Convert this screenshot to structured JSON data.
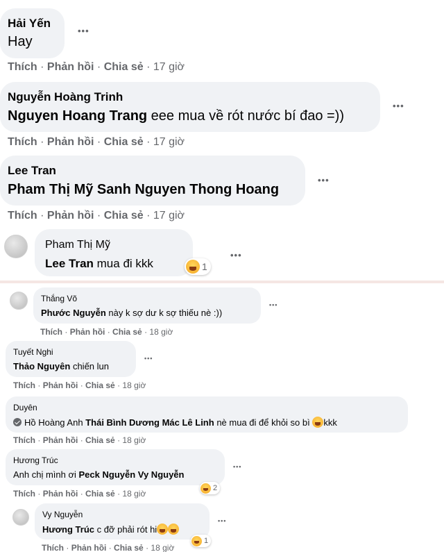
{
  "top_section": {
    "comments": [
      {
        "author": "Hải Yến",
        "text": "Hay",
        "actions": {
          "like": "Thích",
          "reply": "Phản hồi",
          "share": "Chia sẻ",
          "time": "17 giờ"
        }
      },
      {
        "author": "Nguyễn Hoàng Trinh",
        "tag": "Nguyen Hoang Trang",
        "text": " eee mua về rót nước bí đao =))",
        "actions": {
          "like": "Thích",
          "reply": "Phản hồi",
          "share": "Chia sẻ",
          "time": "17 giờ"
        }
      },
      {
        "author": "Lee Tran",
        "tag": "Pham Thị Mỹ Sanh Nguyen Thong Hoang",
        "actions": {
          "like": "Thích",
          "reply": "Phản hồi",
          "share": "Chia sẻ",
          "time": "17 giờ"
        }
      },
      {
        "author": "Pham Thị Mỹ",
        "tag": "Lee Tran",
        "text": " mua đi kkk",
        "reaction_count": "1"
      }
    ]
  },
  "bottom_section": {
    "comments": [
      {
        "author": "Thắng Võ",
        "tag": "Phước Nguyễn",
        "text": " này k sợ dư k sợ thiếu nè :))",
        "actions": {
          "like": "Thích",
          "reply": "Phản hồi",
          "share": "Chia sẻ",
          "time": "18 giờ"
        }
      },
      {
        "author": "Tuyết Nghi",
        "tag": "Thảo Nguyên",
        "text": " chiến lun",
        "actions": {
          "like": "Thích",
          "reply": "Phản hồi",
          "share": "Chia sẻ",
          "time": "18 giờ"
        }
      },
      {
        "author": "Duyên",
        "tag1": "Hồ Hoàng Anh",
        "tag2": "Thái Bình Dương Mác Lê Linh",
        "text": " nè mua đi để khỏi so bì ",
        "text_end": "kkk",
        "actions": {
          "like": "Thích",
          "reply": "Phản hồi",
          "share": "Chia sẻ",
          "time": "18 giờ"
        }
      },
      {
        "author": "Hương Trúc",
        "text": "Anh chị mình ơi ",
        "tag": "Peck Nguyễn Vy Nguyễn",
        "reaction_count": "2",
        "actions": {
          "like": "Thích",
          "reply": "Phản hồi",
          "share": "Chia sẻ",
          "time": "18 giờ"
        }
      },
      {
        "author": "Vy Nguyễn",
        "tag": "Hương Trúc",
        "text": " c đỡ phải rót hi",
        "reaction_count": "1",
        "actions": {
          "like": "Thích",
          "reply": "Phản hồi",
          "share": "Chia sẻ",
          "time": "18 giờ"
        }
      }
    ]
  },
  "dots_label": "•••",
  "separator": "·",
  "icons": {
    "more": "more-options-icon",
    "reaction": "laughing-emoji-icon",
    "verified": "verified-badge-icon"
  },
  "colors": {
    "bubble": "#f0f2f5",
    "meta": "#65676b",
    "text": "#050505",
    "divider": "#f5e6e3"
  }
}
